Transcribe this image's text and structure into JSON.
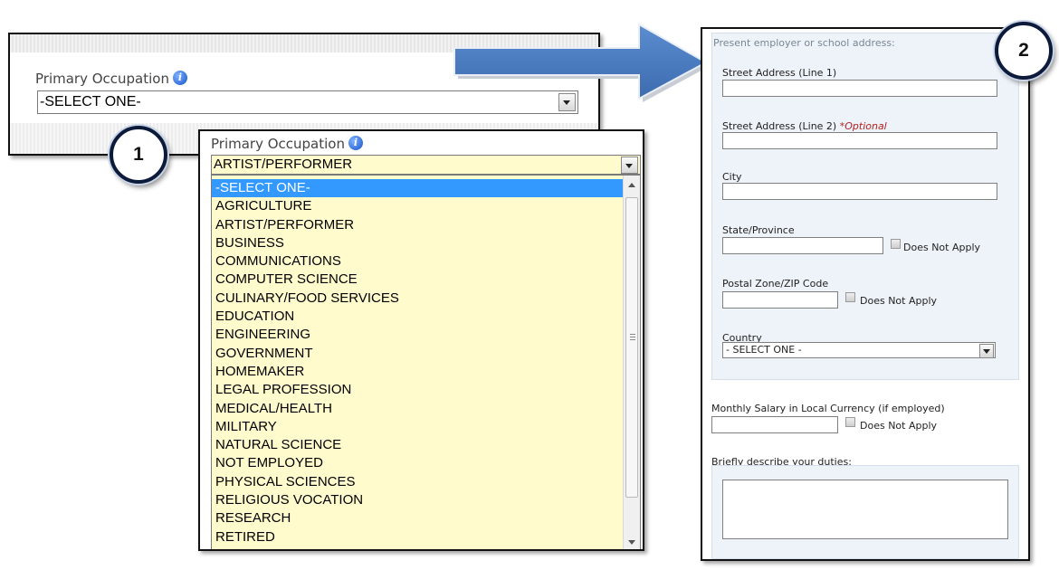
{
  "panel1": {
    "label": "Primary Occupation",
    "info_icon": "info-icon",
    "selected": "-SELECT ONE-"
  },
  "badges": {
    "one": "1",
    "two": "2"
  },
  "panel1b": {
    "label": "Primary Occupation",
    "selected": "ARTIST/PERFORMER",
    "options": [
      "-SELECT ONE-",
      "AGRICULTURE",
      "ARTIST/PERFORMER",
      "BUSINESS",
      "COMMUNICATIONS",
      "COMPUTER SCIENCE",
      "CULINARY/FOOD SERVICES",
      "EDUCATION",
      "ENGINEERING",
      "GOVERNMENT",
      "HOMEMAKER",
      "LEGAL PROFESSION",
      "MEDICAL/HEALTH",
      "MILITARY",
      "NATURAL SCIENCE",
      "NOT EMPLOYED",
      "PHYSICAL SCIENCES",
      "RELIGIOUS VOCATION",
      "RESEARCH",
      "RETIRED"
    ],
    "highlighted_option": "-SELECT ONE-"
  },
  "panel2": {
    "section_title": "Present employer or school address:",
    "street1_label": "Street Address (Line 1)",
    "street2_label": "Street Address (Line 2)",
    "optional_tag": "*Optional",
    "city_label": "City",
    "state_label": "State/Province",
    "does_not_apply": "Does Not Apply",
    "postal_label": "Postal Zone/ZIP Code",
    "country_label": "Country",
    "country_selected": "- SELECT ONE -",
    "salary_label": "Monthly Salary in Local Currency (if employed)",
    "duties_label": "Briefly describe your duties:"
  },
  "colors": {
    "arrow_fill": "#4a7cc0",
    "list_bg": "#fffbcc",
    "highlight": "#3399ff",
    "form_bg": "#eef3f9",
    "optional": "#b02020"
  }
}
